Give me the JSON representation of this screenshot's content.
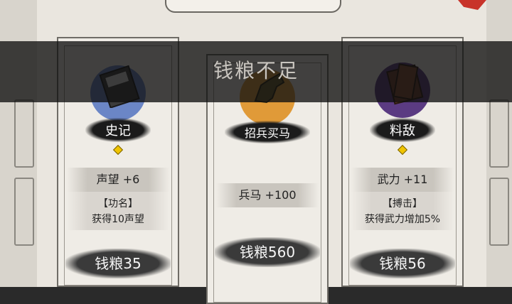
{
  "toast": {
    "message": "钱粮不足"
  },
  "cards": [
    {
      "name": "史记",
      "icon": "book-icon",
      "stat": "声望 +6",
      "skill_title": "【功名】",
      "skill_desc": "获得10声望",
      "price": "钱粮35",
      "icon_color": "#6b86c6"
    },
    {
      "name": "招兵买马",
      "icon": "horse-icon",
      "stat": "兵马 +100",
      "price": "钱粮560",
      "icon_color": "#e09a38"
    },
    {
      "name": "料敌",
      "icon": "scroll-book-icon",
      "stat": "武力 +11",
      "skill_title": "【搏击】",
      "skill_desc": "获得武力增加5%",
      "price": "钱粮56",
      "icon_color": "#5b3b82"
    }
  ],
  "colors": {
    "gem": "#f0c400",
    "close": "#c8332a"
  }
}
